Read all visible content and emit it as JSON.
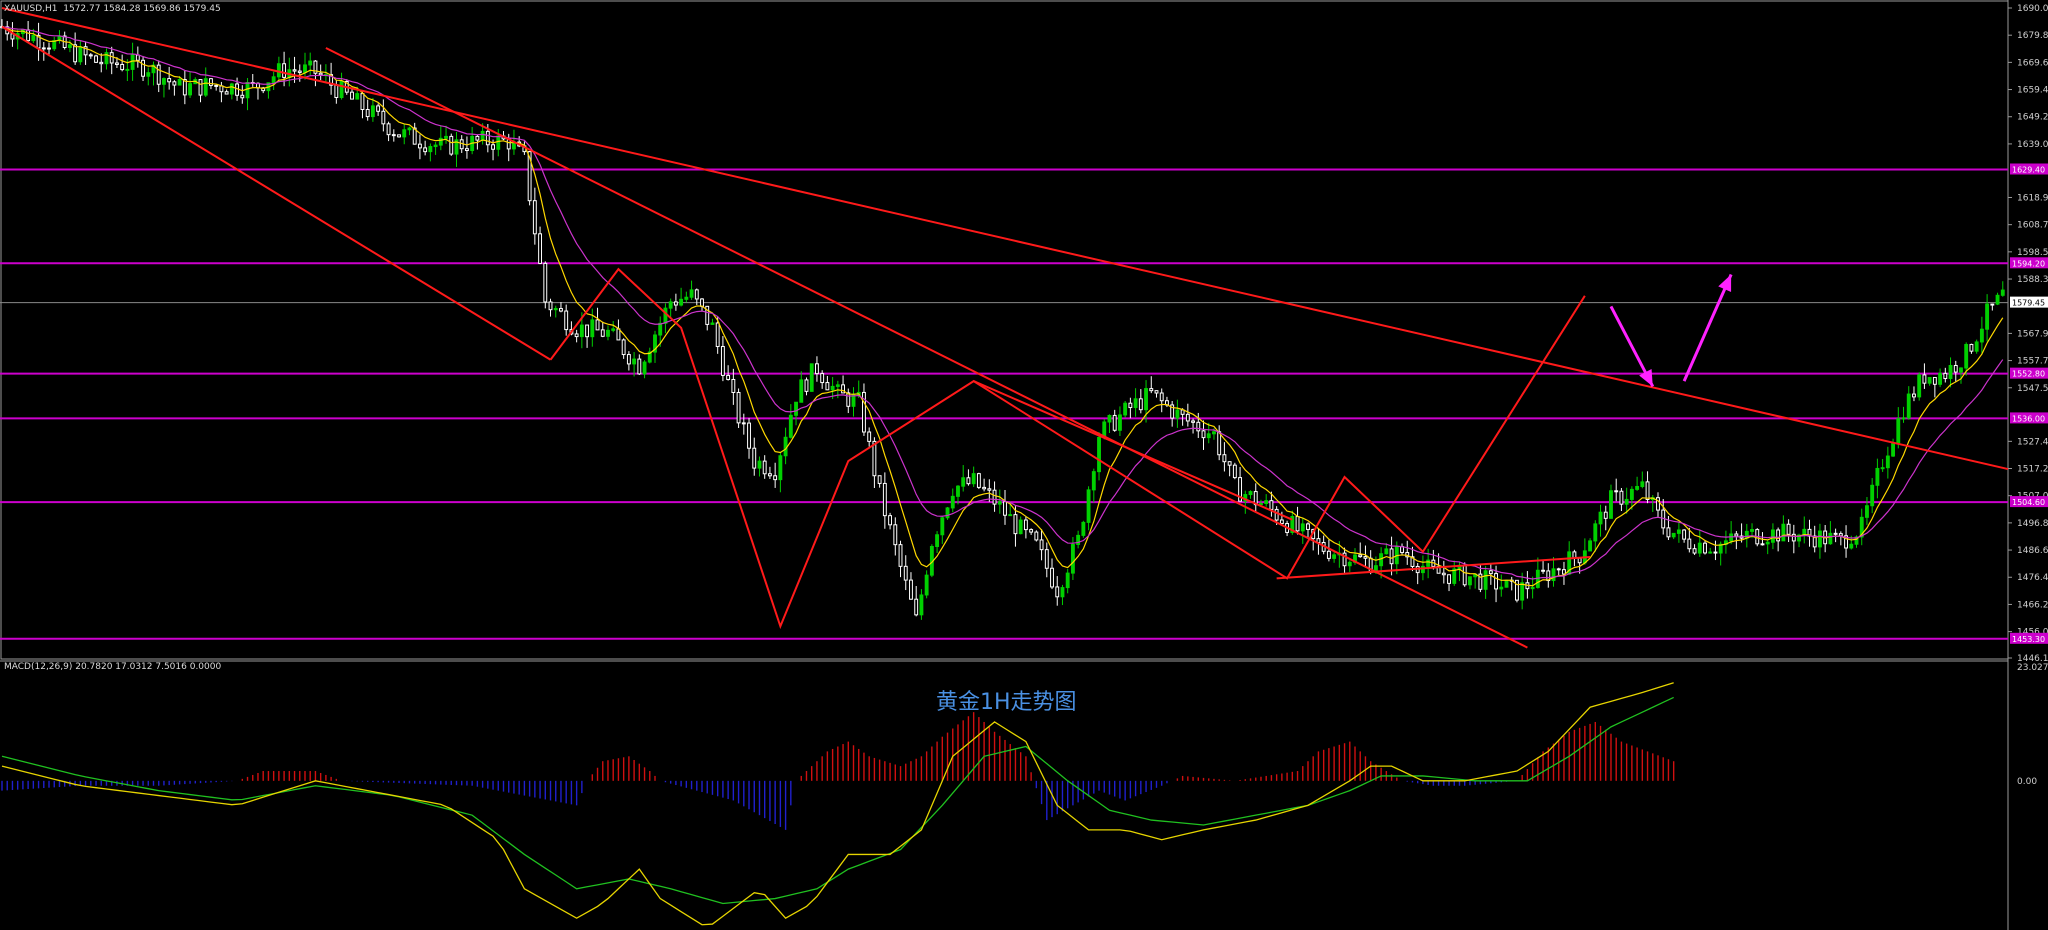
{
  "header": {
    "symbol": "XAUUSD,H1",
    "ohlc": "1572.77 1584.28 1569.86 1579.45",
    "macd_label": "MACD(12,26,9) 20.7820 17.0312 7.5016 0.0000",
    "caption": "黄金1H走势图"
  },
  "colors": {
    "background": "#000000",
    "bull": "#00d000",
    "bear": "#ffffff",
    "trendline": "#ff1a1a",
    "level": "#cc00cc",
    "ma_fast": "#ffd800",
    "ma_slow": "#cc33cc",
    "macd_pos": "#d01010",
    "macd_neg": "#2020cc",
    "macd_line": "#e6d400",
    "signal_line": "#20c020",
    "arrow": "#ff22ff"
  },
  "chart_data": {
    "type": "candlestick",
    "bar_count": 210,
    "price_axis": {
      "min": 1446.1,
      "max": 1690.0,
      "ticks": [
        "1690.00",
        "1679.80",
        "1669.60",
        "1659.40",
        "1649.20",
        "1639.00",
        "1618.90",
        "1608.70",
        "1598.50",
        "1588.30",
        "1567.90",
        "1557.70",
        "1547.50",
        "1527.40",
        "1517.20",
        "1507.00",
        "1496.80",
        "1486.60",
        "1476.40",
        "1466.20",
        "1456.00",
        "1446.10"
      ]
    },
    "price_path": [
      [
        0,
        1683
      ],
      [
        8,
        1678
      ],
      [
        18,
        1670
      ],
      [
        28,
        1668
      ],
      [
        34,
        1660
      ],
      [
        40,
        1661
      ],
      [
        48,
        1660
      ],
      [
        54,
        1667
      ],
      [
        60,
        1666
      ],
      [
        66,
        1657
      ],
      [
        76,
        1643
      ],
      [
        84,
        1638
      ],
      [
        92,
        1640
      ],
      [
        97,
        1640
      ],
      [
        100,
        1633
      ],
      [
        104,
        1580
      ],
      [
        110,
        1570
      ],
      [
        116,
        1568
      ],
      [
        122,
        1556
      ],
      [
        128,
        1580
      ],
      [
        132,
        1582
      ],
      [
        136,
        1570
      ],
      [
        140,
        1542
      ],
      [
        144,
        1520
      ],
      [
        148,
        1517
      ],
      [
        152,
        1545
      ],
      [
        156,
        1555
      ],
      [
        160,
        1545
      ],
      [
        164,
        1542
      ],
      [
        168,
        1508
      ],
      [
        172,
        1480
      ],
      [
        175,
        1460
      ],
      [
        178,
        1490
      ],
      [
        182,
        1510
      ],
      [
        186,
        1512
      ],
      [
        190,
        1505
      ],
      [
        194,
        1496
      ],
      [
        198,
        1488
      ],
      [
        202,
        1472
      ],
      [
        206,
        1490
      ],
      [
        210,
        1530
      ],
      [
        216,
        1540
      ],
      [
        220,
        1545
      ],
      [
        226,
        1536
      ],
      [
        232,
        1530
      ],
      [
        236,
        1510
      ],
      [
        242,
        1503
      ],
      [
        246,
        1497
      ],
      [
        252,
        1488
      ],
      [
        258,
        1484
      ],
      [
        262,
        1482
      ],
      [
        268,
        1486
      ],
      [
        274,
        1478
      ],
      [
        280,
        1477
      ],
      [
        286,
        1474
      ],
      [
        290,
        1471
      ],
      [
        296,
        1478
      ],
      [
        302,
        1485
      ],
      [
        308,
        1505
      ],
      [
        314,
        1510
      ],
      [
        318,
        1496
      ],
      [
        322,
        1490
      ],
      [
        328,
        1488
      ],
      [
        334,
        1492
      ],
      [
        340,
        1493
      ],
      [
        346,
        1492
      ],
      [
        352,
        1490
      ],
      [
        356,
        1495
      ],
      [
        360,
        1520
      ],
      [
        364,
        1540
      ],
      [
        368,
        1552
      ],
      [
        372,
        1553
      ],
      [
        376,
        1560
      ],
      [
        380,
        1575
      ],
      [
        383,
        1582
      ]
    ],
    "resistance_levels": [
      1629.4,
      1594.2,
      1552.8,
      1536.0,
      1504.6,
      1453.3
    ],
    "level_tags": [
      "1629.40",
      "1594.20",
      "1552.80",
      "1536.00",
      "1504.60",
      "1453.30"
    ],
    "current_price": 1579.45,
    "current_price_tag": "1579.45",
    "trendlines": [
      {
        "from": [
          0,
          1690
        ],
        "to": [
          384,
          1517
        ]
      },
      {
        "from": [
          0,
          1683
        ],
        "to": [
          105,
          1558
        ]
      },
      {
        "from": [
          62,
          1675
        ],
        "to": [
          292,
          1450
        ]
      },
      {
        "from": [
          186,
          1550
        ],
        "to": [
          247,
          1498
        ]
      },
      {
        "from": [
          244,
          1476
        ],
        "to": [
          304,
          1484
        ]
      }
    ],
    "zigzag": [
      [
        105,
        1558
      ],
      [
        118,
        1592
      ],
      [
        130,
        1570
      ],
      [
        149,
        1458
      ],
      [
        162,
        1520
      ],
      [
        186,
        1550
      ],
      [
        246,
        1476
      ],
      [
        257,
        1514
      ],
      [
        272,
        1486
      ],
      [
        303,
        1582
      ]
    ],
    "forecast_arrows": [
      {
        "from": [
          308,
          1578
        ],
        "to": [
          316,
          1548
        ]
      },
      {
        "from": [
          322,
          1550
        ],
        "to": [
          331,
          1590
        ]
      }
    ],
    "macd": {
      "label": "MACD(12,26,9)",
      "values": [
        20.782,
        17.0312,
        7.5016,
        0.0
      ],
      "axis_top": "23.0279",
      "axis_zero": "0.00",
      "hist_path": [
        [
          0,
          -2
        ],
        [
          15,
          -1
        ],
        [
          30,
          -1
        ],
        [
          45,
          0
        ],
        [
          50,
          2
        ],
        [
          60,
          2
        ],
        [
          65,
          0
        ],
        [
          90,
          -1
        ],
        [
          110,
          -5
        ],
        [
          112,
          0
        ],
        [
          115,
          4
        ],
        [
          120,
          5
        ],
        [
          124,
          2
        ],
        [
          126,
          0
        ],
        [
          140,
          -4
        ],
        [
          150,
          -10
        ],
        [
          152,
          0
        ],
        [
          158,
          6
        ],
        [
          162,
          8
        ],
        [
          166,
          5
        ],
        [
          172,
          3
        ],
        [
          176,
          5
        ],
        [
          180,
          9
        ],
        [
          186,
          14
        ],
        [
          190,
          10
        ],
        [
          196,
          5
        ],
        [
          200,
          -8
        ],
        [
          210,
          -2
        ],
        [
          215,
          -4
        ],
        [
          222,
          -1
        ],
        [
          226,
          1
        ],
        [
          236,
          0
        ],
        [
          248,
          2
        ],
        [
          252,
          6
        ],
        [
          258,
          8
        ],
        [
          262,
          4
        ],
        [
          268,
          0
        ],
        [
          274,
          -1
        ],
        [
          280,
          -1
        ],
        [
          290,
          0
        ],
        [
          295,
          6
        ],
        [
          300,
          10
        ],
        [
          305,
          12
        ],
        [
          310,
          8
        ],
        [
          315,
          6
        ],
        [
          320,
          4
        ]
      ],
      "macd_path": [
        [
          0,
          3
        ],
        [
          15,
          -1
        ],
        [
          30,
          -3
        ],
        [
          45,
          -5
        ],
        [
          60,
          0
        ],
        [
          70,
          -2
        ],
        [
          85,
          -5
        ],
        [
          95,
          -12
        ],
        [
          100,
          -22
        ],
        [
          110,
          -28
        ],
        [
          115,
          -25
        ],
        [
          122,
          -18
        ],
        [
          126,
          -24
        ],
        [
          135,
          -30
        ],
        [
          145,
          -22
        ],
        [
          150,
          -28
        ],
        [
          155,
          -25
        ],
        [
          162,
          -15
        ],
        [
          170,
          -15
        ],
        [
          176,
          -10
        ],
        [
          182,
          5
        ],
        [
          190,
          12
        ],
        [
          196,
          8
        ],
        [
          202,
          -5
        ],
        [
          208,
          -10
        ],
        [
          215,
          -10
        ],
        [
          222,
          -12
        ],
        [
          230,
          -10
        ],
        [
          240,
          -8
        ],
        [
          250,
          -5
        ],
        [
          258,
          0
        ],
        [
          262,
          3
        ],
        [
          266,
          3
        ],
        [
          272,
          0
        ],
        [
          280,
          0
        ],
        [
          290,
          2
        ],
        [
          296,
          6
        ],
        [
          304,
          15
        ],
        [
          314,
          18
        ],
        [
          320,
          20
        ]
      ],
      "signal_path": [
        [
          0,
          5
        ],
        [
          15,
          1
        ],
        [
          30,
          -2
        ],
        [
          45,
          -4
        ],
        [
          60,
          -1
        ],
        [
          75,
          -3
        ],
        [
          90,
          -7
        ],
        [
          100,
          -15
        ],
        [
          110,
          -22
        ],
        [
          120,
          -20
        ],
        [
          128,
          -22
        ],
        [
          138,
          -25
        ],
        [
          148,
          -24
        ],
        [
          156,
          -22
        ],
        [
          162,
          -18
        ],
        [
          172,
          -14
        ],
        [
          180,
          -5
        ],
        [
          188,
          5
        ],
        [
          196,
          7
        ],
        [
          204,
          0
        ],
        [
          212,
          -6
        ],
        [
          220,
          -8
        ],
        [
          230,
          -9
        ],
        [
          240,
          -7
        ],
        [
          250,
          -5
        ],
        [
          258,
          -2
        ],
        [
          264,
          1
        ],
        [
          272,
          1
        ],
        [
          282,
          0
        ],
        [
          292,
          0
        ],
        [
          300,
          5
        ],
        [
          308,
          11
        ],
        [
          314,
          14
        ],
        [
          320,
          17
        ]
      ],
      "min": -30,
      "max": 23
    }
  }
}
